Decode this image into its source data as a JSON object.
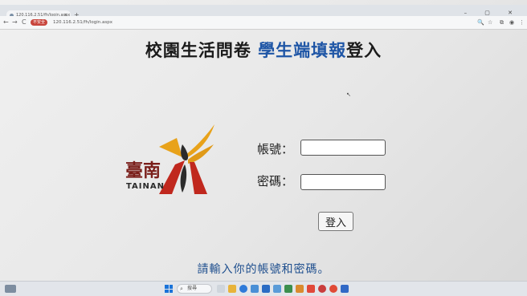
{
  "browser": {
    "tab_title": "120.116.2.51/fh/login.aspx",
    "tab_close": "×",
    "new_tab": "+",
    "window_controls": "– ▢ ✕",
    "nav_back": "←",
    "nav_forward": "→",
    "nav_reload": "C",
    "security_badge": "不安全",
    "url": "120.116.2.51/fh/login.aspx",
    "zoom_icon": "🔍",
    "star_icon": "☆",
    "extensions_icon": "⧉",
    "profile_icon": "◉",
    "menu_icon": "⋮"
  },
  "page": {
    "title_prefix": "校園生活問卷 ",
    "title_highlight": "學生端填報",
    "title_suffix": "登入",
    "logo_text": "TAINAN",
    "logo_glyphs": "臺南",
    "account_label": "帳號：",
    "password_label": "密碼：",
    "account_value": "",
    "password_value": "",
    "login_button": "登入",
    "hint": "請輸入你的帳號和密碼。",
    "cursor_glyph": "↖"
  },
  "taskbar": {
    "search_label": "搜尋",
    "search_icon": "⌕"
  },
  "colors": {
    "title_highlight": "#1f56a6",
    "hint": "#20508f",
    "logo_yellow": "#e8a21a",
    "logo_red": "#c0281e",
    "logo_dark": "#2b2b2b"
  }
}
